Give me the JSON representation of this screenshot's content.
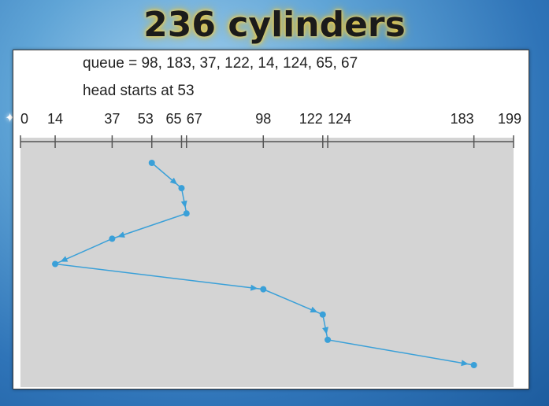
{
  "title": "236 cylinders",
  "queue_text": "queue = 98, 183, 37, 122, 14, 124, 65, 67",
  "head_text": "head starts at 53",
  "axis_ticks": [
    "0",
    "14",
    "37",
    "53",
    "65",
    "67",
    "98",
    "122",
    "124",
    "183",
    "199"
  ],
  "chart_data": {
    "type": "line",
    "x_range": [
      0,
      199
    ],
    "head_start": 53,
    "queue": [
      98,
      183,
      37,
      122,
      14,
      124,
      65,
      67
    ],
    "service_order": [
      53,
      65,
      67,
      37,
      14,
      98,
      122,
      124,
      183
    ],
    "series_color": "#3aa0d8",
    "background_color": "#d4d4d4"
  }
}
